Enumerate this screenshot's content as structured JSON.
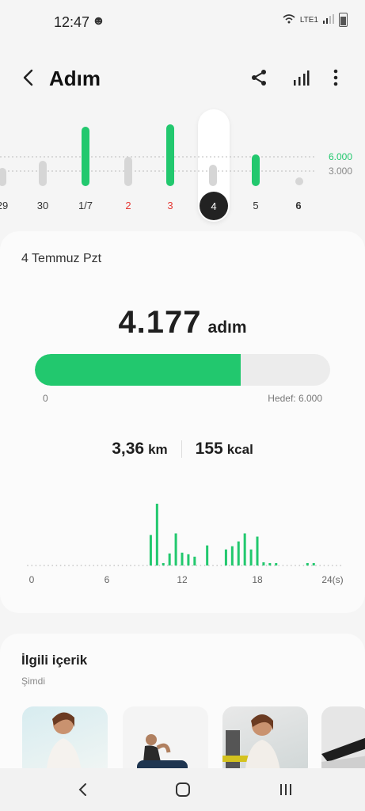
{
  "status": {
    "time": "12:47",
    "network": "LTE1"
  },
  "header": {
    "title": "Adım"
  },
  "week_chart": {
    "days": [
      "29",
      "30",
      "1/7",
      "2",
      "3",
      "4",
      "5",
      "6"
    ],
    "goal_labels": [
      "6.000",
      "3.000"
    ],
    "selected_day": "4",
    "colors": {
      "goal_met": "#22c86e",
      "below": "#d6d6d6",
      "weekend": "#e53935"
    }
  },
  "summary": {
    "date": "4 Temmuz Pzt",
    "steps": "4.177",
    "steps_unit": "adım",
    "progress_fraction": 0.696,
    "progress_min_label": "0",
    "goal_label": "Hedef: 6.000",
    "distance": "3,36",
    "distance_unit": "km",
    "calories": "155",
    "calories_unit": "kcal"
  },
  "chart_data": {
    "type": "bar",
    "title": "",
    "xlabel": "",
    "ylabel": "",
    "x_ticks": [
      "0",
      "6",
      "12",
      "18",
      "24(s)"
    ],
    "xlim": [
      0,
      24
    ],
    "bar_color": "#22c86e",
    "x": [
      9.5,
      10,
      10.5,
      11,
      11.5,
      12,
      12.5,
      13,
      14,
      15.5,
      16,
      16.5,
      17,
      17.5,
      18,
      18.5,
      19,
      19.5,
      22,
      22.5
    ],
    "values": [
      38,
      77,
      3,
      15,
      40,
      16,
      14,
      11,
      25,
      20,
      24,
      30,
      40,
      20,
      36,
      4,
      3,
      3,
      3,
      3
    ]
  },
  "related": {
    "title": "İlgili içerik",
    "subtitle": "Şimdi"
  }
}
